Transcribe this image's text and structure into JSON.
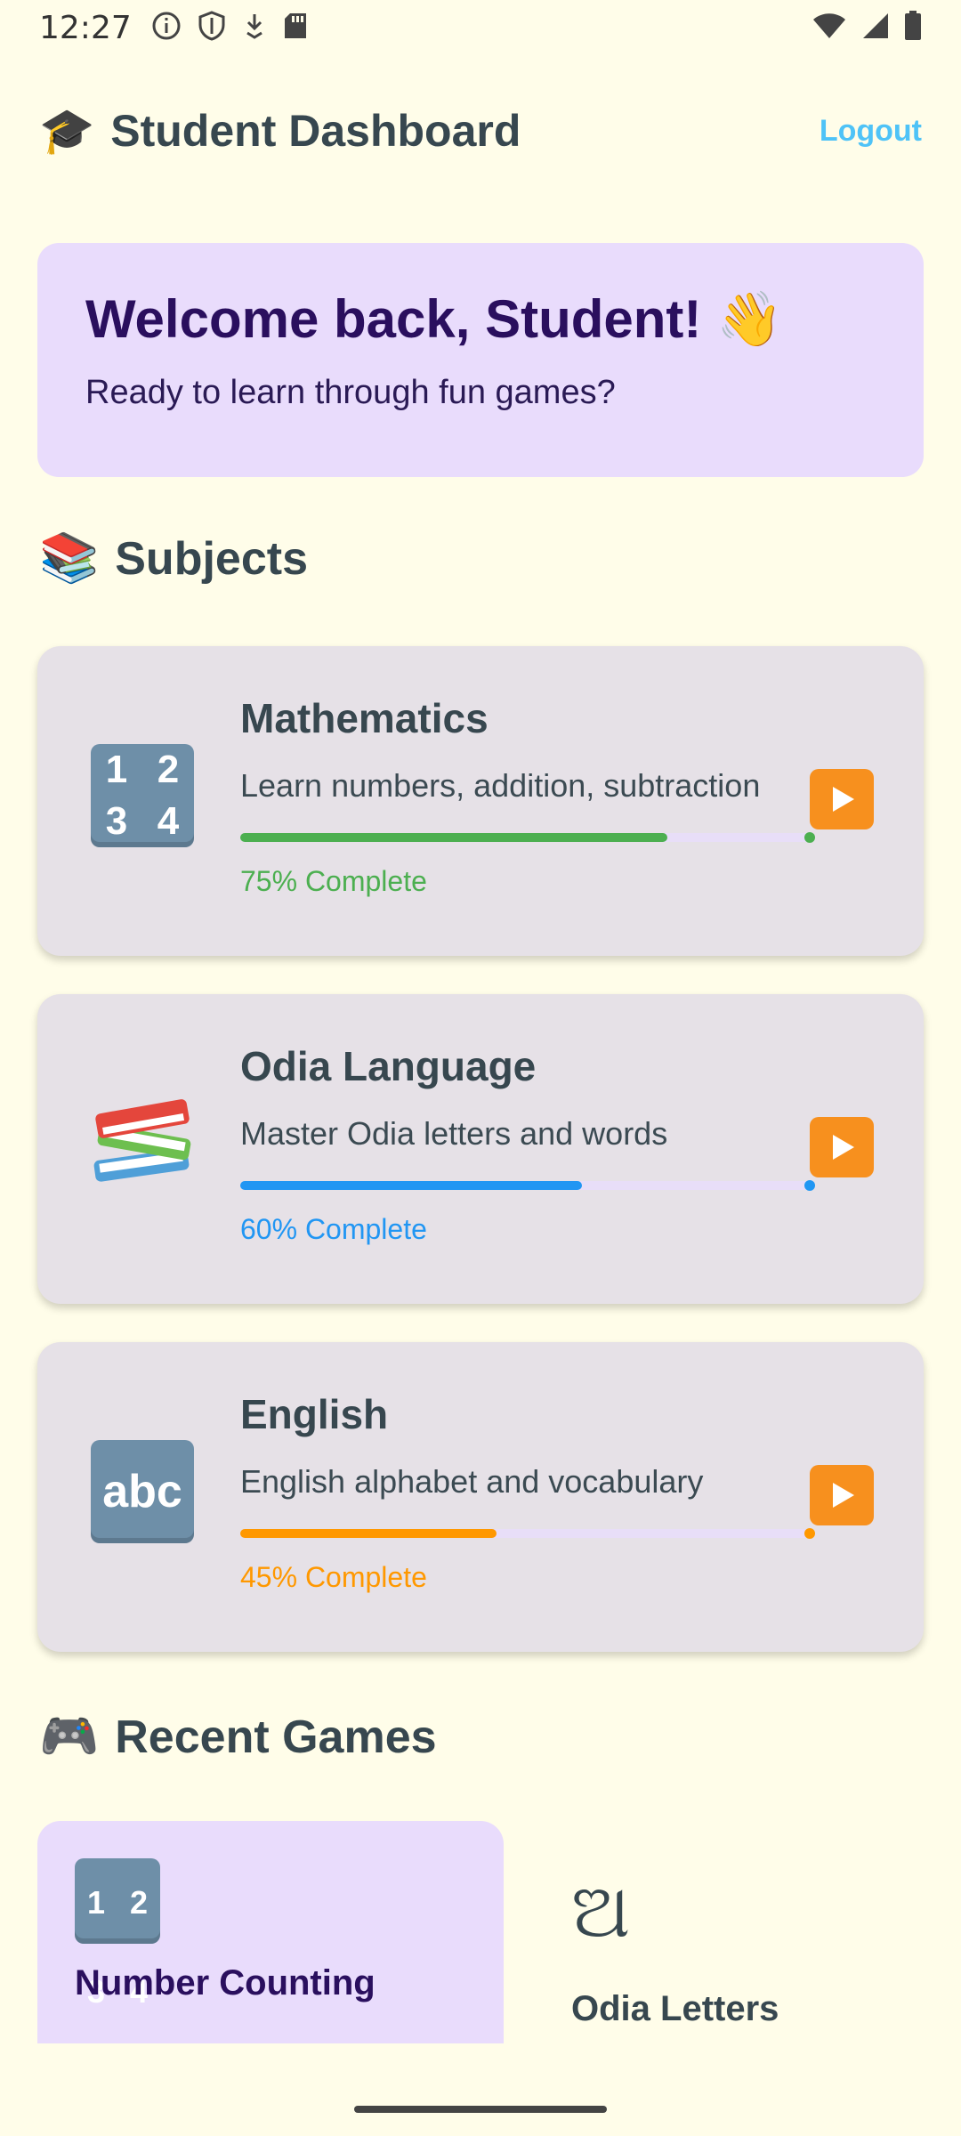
{
  "status_bar": {
    "time": "12:27",
    "icons_left": [
      "info-icon",
      "shield-icon",
      "download-icon",
      "sd-card-icon"
    ],
    "icons_right": [
      "wifi-icon",
      "signal-icon",
      "battery-icon"
    ]
  },
  "header": {
    "emoji": "🎓",
    "title": "Student Dashboard",
    "logout_label": "Logout"
  },
  "welcome": {
    "title": "Welcome back, Student! 👋",
    "subtitle": "Ready to learn through fun games?"
  },
  "subjects_section": {
    "emoji": "📚",
    "title": "Subjects"
  },
  "subjects": [
    {
      "name": "Mathematics",
      "description": "Learn numbers, addition, subtraction",
      "progress": 0.75,
      "progress_label": "75% Complete",
      "color": "#4caf50",
      "icon": "numbers-icon"
    },
    {
      "name": "Odia Language",
      "description": "Master Odia letters and words",
      "progress": 0.6,
      "progress_label": "60% Complete",
      "color": "#2196f3",
      "icon": "books-icon"
    },
    {
      "name": "English",
      "description": "English alphabet and vocabulary",
      "progress": 0.45,
      "progress_label": "45% Complete",
      "color": "#ff9800",
      "icon": "abc-icon"
    }
  ],
  "games_section": {
    "emoji": "🎮",
    "title": "Recent Games"
  },
  "games": [
    {
      "name": "Number Counting",
      "icon": "numbers-icon"
    },
    {
      "name": "Odia Letters",
      "icon_glyph": "ଅ"
    }
  ],
  "colors": {
    "background": "#fffde9",
    "welcome_bg": "#e9dcfc",
    "card_bg": "#e6e1e7",
    "play_button": "#f7901e",
    "logout": "#4fc3f7"
  }
}
